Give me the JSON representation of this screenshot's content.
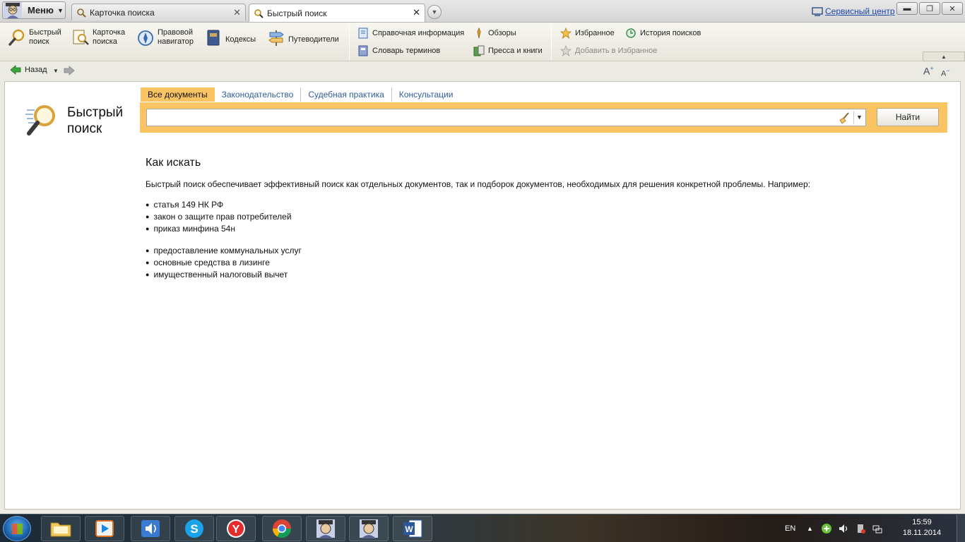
{
  "app": {
    "menu_label": "Меню",
    "tabs": [
      {
        "label": "Карточка поиска",
        "active": false
      },
      {
        "label": "Быстрый поиск",
        "active": true
      }
    ],
    "service_center": "Сервисный центр"
  },
  "toolbar": {
    "big": [
      {
        "label1": "Быстрый",
        "label2": "поиск"
      },
      {
        "label1": "Карточка",
        "label2": "поиска"
      },
      {
        "label1": "Правовой",
        "label2": "навигатор"
      },
      {
        "label1": "Кодексы",
        "label2": ""
      },
      {
        "label1": "Путеводители",
        "label2": ""
      }
    ],
    "ref_info": "Справочная информация",
    "glossary": "Словарь терминов",
    "reviews": "Обзоры",
    "press": "Пресса и книги",
    "favorites": "Избранное",
    "history": "История поисков",
    "add_favorites": "Добавить в Избранное"
  },
  "nav": {
    "back_label": "Назад"
  },
  "quick_search": {
    "title_line1": "Быстрый",
    "title_line2": "поиск",
    "tabs": [
      "Все документы",
      "Законодательство",
      "Судебная практика",
      "Консультации"
    ],
    "active_tab": 0,
    "input_value": "",
    "find_button": "Найти"
  },
  "howto": {
    "heading": "Как искать",
    "description": "Быстрый поиск обеспечивает эффективный поиск как отдельных документов, так и подборок документов, необходимых для решения конкретной проблемы. Например:",
    "examples_group1": [
      "статья 149 НК РФ",
      "закон о защите прав потребителей",
      "приказ минфина 54н"
    ],
    "examples_group2": [
      "предоставление коммунальных услуг",
      "основные средства в лизинге",
      "имущественный налоговый вычет"
    ]
  },
  "taskbar": {
    "language": "EN",
    "time": "15:59",
    "date": "18.11.2014"
  },
  "colors": {
    "search_band": "#fbc463",
    "link_blue": "#2f5d9a",
    "content_bg": "#ffffff",
    "chrome_bg": "#ecebe3"
  }
}
